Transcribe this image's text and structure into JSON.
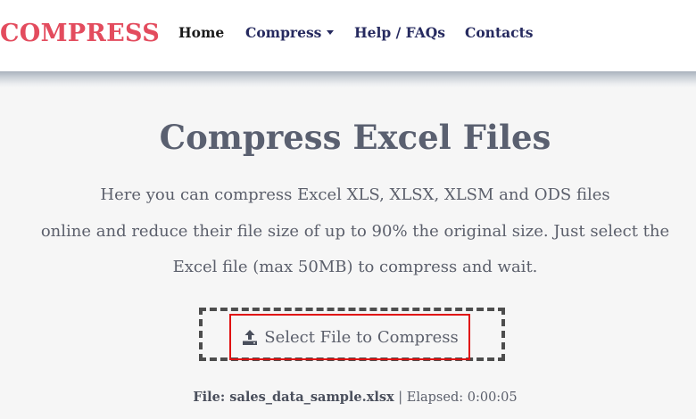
{
  "navbar": {
    "brand": "COMPRESS",
    "links": [
      {
        "label": "Home"
      },
      {
        "label": "Compress"
      },
      {
        "label": "Help / FAQs"
      },
      {
        "label": "Contacts"
      }
    ]
  },
  "main": {
    "title": "Compress Excel Files",
    "description_lines": [
      "Here you can compress Excel XLS, XLSX, XLSM and ODS files",
      "online and reduce their file size of up to 90% the original size. Just select the",
      "Excel file (max 50MB) to compress and wait."
    ],
    "select_button": "Select File to Compress",
    "upload_icon": "upload-icon"
  },
  "status": {
    "file_label": "File: sales_data_sample.xlsx",
    "separator": " | ",
    "elapsed": "Elapsed: 0:00:05"
  },
  "colors": {
    "brand": "#e34c5e",
    "nav_text": "#262a5f",
    "highlight_border": "#e01010"
  }
}
